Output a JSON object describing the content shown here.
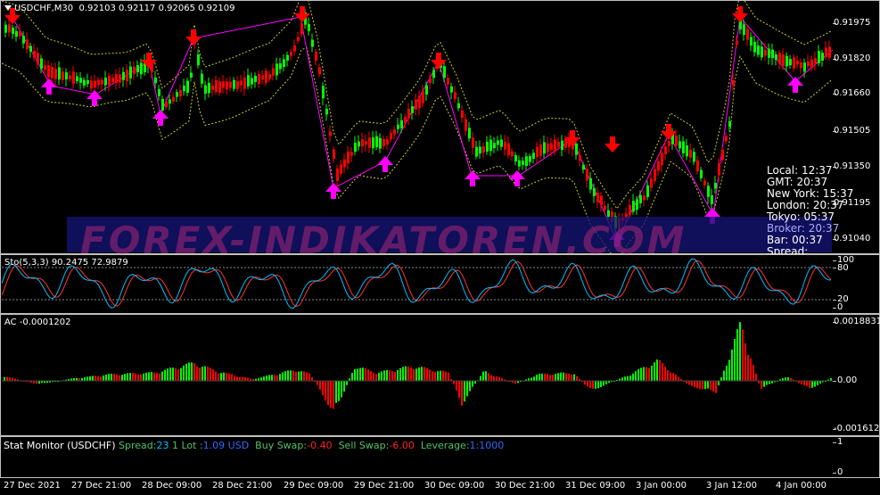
{
  "main": {
    "symbol": "USDCHF,M30",
    "ohlc": "0.92103 0.92117 0.92065 0.92109",
    "price_levels": [
      "0.91975",
      "0.91820",
      "0.91660",
      "0.91505",
      "0.91350",
      "0.91195",
      "0.91040"
    ],
    "current_price": "0.92109",
    "watermark": "FOREX-INDIKATOREN.COM"
  },
  "info_panel": {
    "local": "Local: 12:37",
    "gmt": "GMT: 20:37",
    "new_york": "New York: 15:37",
    "london": "London: 20:37",
    "tokyo": "Tokyo: 05:37",
    "broker": "Broker: 20:37",
    "bar": "Bar: 00:37",
    "spread": "Spread:"
  },
  "stochastic": {
    "label": "Sto(5,3,3) 90.2475 72.9879",
    "levels": [
      "100",
      "80",
      "20",
      "0"
    ]
  },
  "ac": {
    "label": "AC -0.0001202",
    "levels": [
      "0.0018831",
      "0.00",
      "-0.0016122"
    ]
  },
  "stat_monitor": {
    "title": "Stat Monitor (USDCHF)",
    "spread_label": "Spread:",
    "spread_value": "23",
    "lot_label": "1 Lot :",
    "lot_value": "1.09 USD",
    "buy_swap_label": "Buy Swap:",
    "buy_swap_value": "-0.40",
    "sell_swap_label": "Sell Swap:",
    "sell_swap_value": "-6.00",
    "leverage_label": "Leverage:",
    "leverage_value": "1:1000",
    "levels": [
      "1",
      "0"
    ]
  },
  "time_axis": [
    "27 Dec 2021",
    "27 Dec 21:00",
    "28 Dec 09:00",
    "28 Dec 21:00",
    "29 Dec 09:00",
    "29 Dec 21:00",
    "30 Dec 09:00",
    "30 Dec 21:00",
    "31 Dec 09:00",
    "3 Jan 00:00",
    "3 Jan 12:00",
    "4 Jan 00:00"
  ],
  "colors": {
    "bull_candle": "#00ff00",
    "bear_candle": "#ff0000",
    "buy_arrow": "#ff00ff",
    "sell_arrow": "#ff0000",
    "envelope": "#cccc33",
    "zigzag": "#ff00ff",
    "stoch_main": "#00bfff",
    "stoch_signal": "#ff3333",
    "spread_value": "#00bfff",
    "lot_value": "#3366ff",
    "buy_swap_label": "#55c06a",
    "buy_swap_value": "#ff2020",
    "sell_swap_label": "#55c06a",
    "sell_swap_value": "#ff2020",
    "leverage_label": "#00bfff",
    "leverage_value": "#3366ff"
  }
}
